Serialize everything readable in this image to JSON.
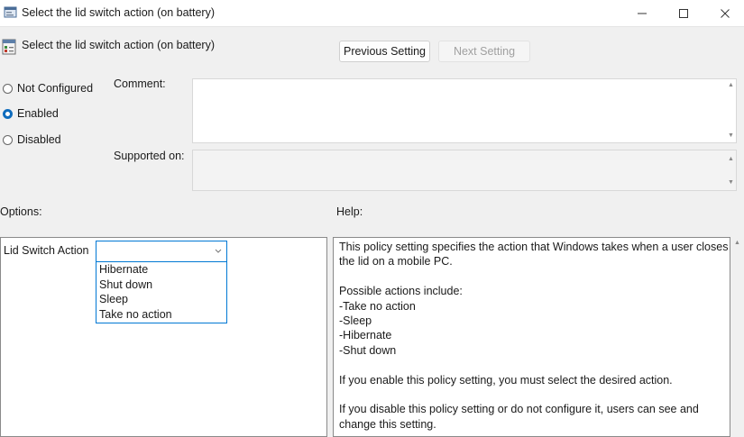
{
  "window": {
    "title": "Select the lid switch action (on battery)",
    "controls": {
      "minimize": "minimize-icon",
      "maximize": "maximize-icon",
      "close": "close-icon"
    }
  },
  "header": {
    "policy_title": "Select the lid switch action (on battery)",
    "previous_label": "Previous Setting",
    "next_label": "Next Setting"
  },
  "state": {
    "options": [
      {
        "label": "Not Configured",
        "checked": false
      },
      {
        "label": "Enabled",
        "checked": true
      },
      {
        "label": "Disabled",
        "checked": false
      }
    ]
  },
  "fields": {
    "comment_label": "Comment:",
    "comment_value": "",
    "supported_label": "Supported on:",
    "supported_value": ""
  },
  "sections": {
    "options_label": "Options:",
    "help_label": "Help:"
  },
  "lid_switch": {
    "label": "Lid Switch Action",
    "selected": "",
    "choices": [
      "Hibernate",
      "Shut down",
      "Sleep",
      "Take no action"
    ]
  },
  "help": {
    "p1": "This policy setting specifies the action that Windows takes when a user closes the lid on a mobile PC.",
    "p2_title": "Possible actions include:",
    "actions": [
      "-Take no action",
      "-Sleep",
      "-Hibernate",
      "-Shut down"
    ],
    "p3": "If you enable this policy setting, you must select the desired action.",
    "p4": "If you disable this policy setting or do not configure it, users can see and change this setting."
  },
  "colors": {
    "accent": "#0f6cbd",
    "focus": "#0078d4",
    "window_bg": "#f0f0f0"
  }
}
